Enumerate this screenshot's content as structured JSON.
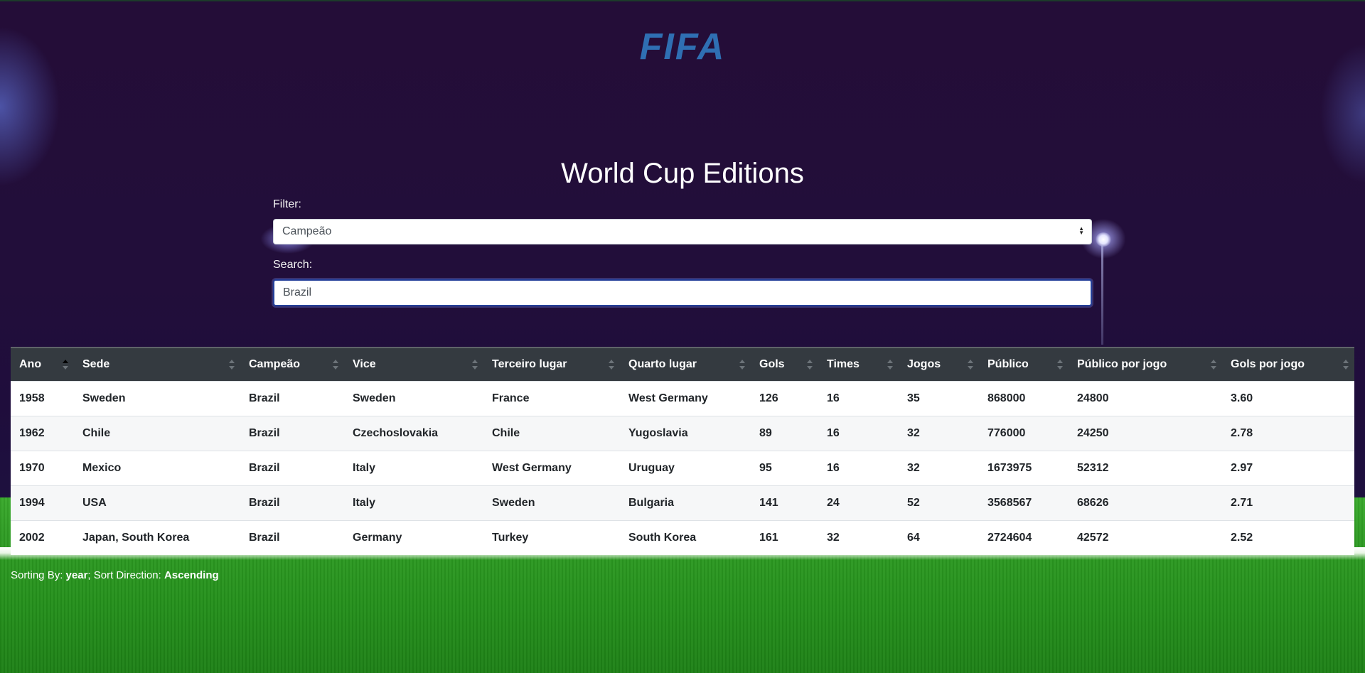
{
  "logo": {
    "text": "FIFA",
    "color": "#2f6fb3"
  },
  "title": "World Cup Editions",
  "filter": {
    "label": "Filter:",
    "selected": "Campeão"
  },
  "search": {
    "label": "Search:",
    "value": "Brazil"
  },
  "table": {
    "columns": [
      "Ano",
      "Sede",
      "Campeão",
      "Vice",
      "Terceiro lugar",
      "Quarto lugar",
      "Gols",
      "Times",
      "Jogos",
      "Público",
      "Público por jogo",
      "Gols por jogo"
    ],
    "sorted_column": "Ano",
    "rows": [
      [
        "1958",
        "Sweden",
        "Brazil",
        "Sweden",
        "France",
        "West Germany",
        "126",
        "16",
        "35",
        "868000",
        "24800",
        "3.60"
      ],
      [
        "1962",
        "Chile",
        "Brazil",
        "Czechoslovakia",
        "Chile",
        "Yugoslavia",
        "89",
        "16",
        "32",
        "776000",
        "24250",
        "2.78"
      ],
      [
        "1970",
        "Mexico",
        "Brazil",
        "Italy",
        "West Germany",
        "Uruguay",
        "95",
        "16",
        "32",
        "1673975",
        "52312",
        "2.97"
      ],
      [
        "1994",
        "USA",
        "Brazil",
        "Italy",
        "Sweden",
        "Bulgaria",
        "141",
        "24",
        "52",
        "3568567",
        "68626",
        "2.71"
      ],
      [
        "2002",
        "Japan, South Korea",
        "Brazil",
        "Germany",
        "Turkey",
        "South Korea",
        "161",
        "32",
        "64",
        "2724604",
        "42572",
        "2.52"
      ]
    ]
  },
  "status": {
    "sorting_by_label": "Sorting By: ",
    "sorting_by_value": "year",
    "direction_label": "; Sort Direction: ",
    "direction_value": "Ascending"
  },
  "colors": {
    "header_bg": "#343a40",
    "page_bg": "#230f38",
    "grass": "#2f9d24"
  }
}
